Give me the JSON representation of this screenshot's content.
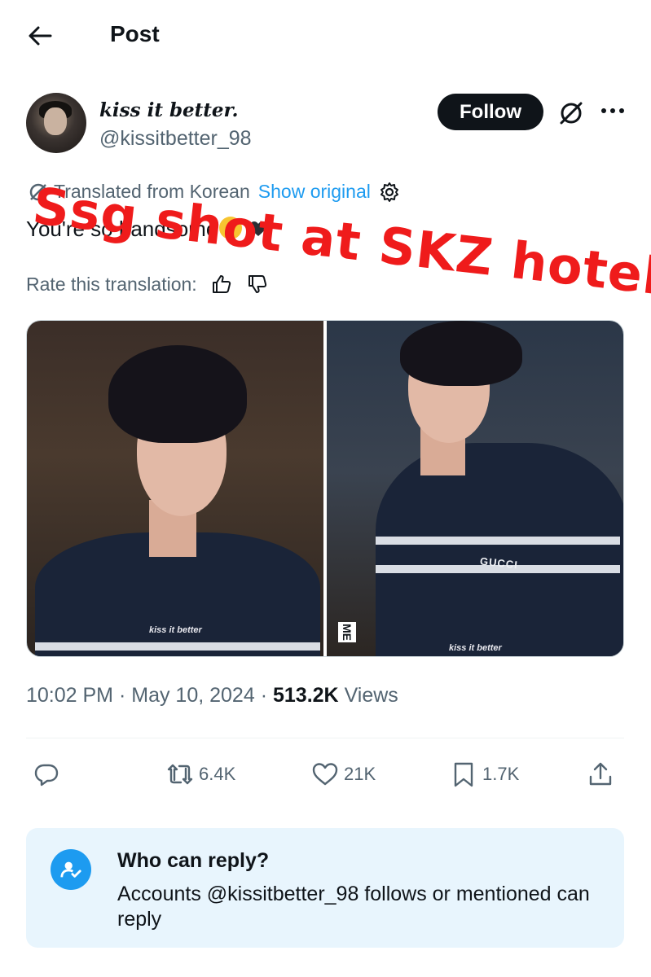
{
  "header": {
    "title": "Post"
  },
  "author": {
    "display_name": "kiss it better.",
    "handle": "@kissitbetter_98",
    "follow_label": "Follow"
  },
  "translation": {
    "notice": "Translated from Korean",
    "show_original": "Show original",
    "rate_label": "Rate this translation:"
  },
  "tweet": {
    "text": "You're so handsome"
  },
  "overlay_caption": "Ssg shot at SKZ hotel!",
  "media": {
    "photos": [
      {
        "caption": "kiss it better"
      },
      {
        "caption": "kiss it better",
        "brand": "GUCCI",
        "side_label": "ME"
      }
    ]
  },
  "meta": {
    "time": "10:02 PM",
    "date": "May 10, 2024",
    "views_count": "513.2K",
    "views_label": "Views",
    "separator": "·"
  },
  "actions": {
    "retweets": "6.4K",
    "likes": "21K",
    "bookmarks": "1.7K"
  },
  "reply_settings": {
    "title": "Who can reply?",
    "description": "Accounts @kissitbetter_98 follows or mentioned can reply"
  },
  "colors": {
    "accent": "#1d9bf0",
    "overlay_red": "#ef1b1b",
    "muted": "#536471"
  }
}
